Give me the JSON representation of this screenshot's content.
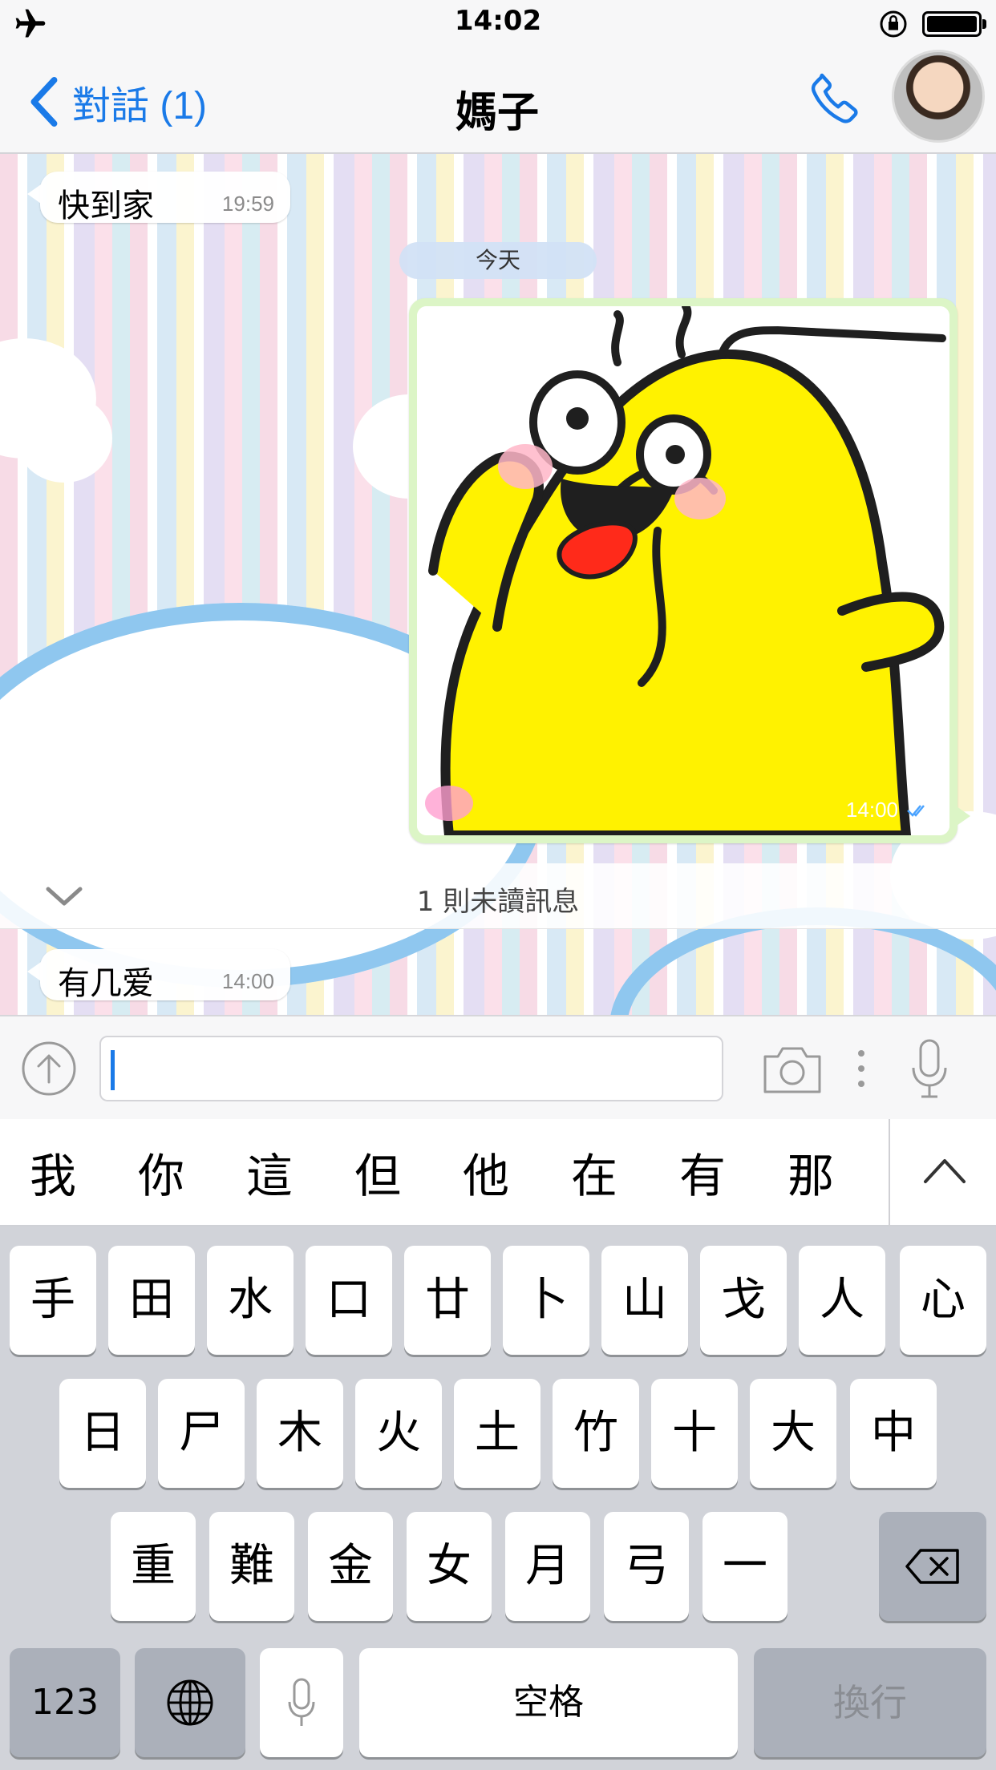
{
  "status_bar": {
    "time": "14:02",
    "icons": [
      "airplane-icon",
      "rotation-lock-icon",
      "battery-icon"
    ]
  },
  "nav": {
    "back_label": "對話 (1)",
    "title": "媽子",
    "phone_icon": "phone-icon",
    "avatar_icon": "avatar"
  },
  "chat": {
    "messages": [
      {
        "direction": "incoming",
        "text": "快到家",
        "time": "19:59"
      },
      {
        "direction": "outgoing",
        "type": "sticker",
        "time": "14:00",
        "status": "read-checkmarks"
      },
      {
        "direction": "incoming",
        "text": "有几爱",
        "time": "14:00"
      }
    ],
    "date_divider": "今天",
    "unread_banner": "1 則未讀訊息"
  },
  "input": {
    "value": "",
    "placeholder": ""
  },
  "candidates": [
    "我",
    "你",
    "這",
    "但",
    "他",
    "在",
    "有",
    "那"
  ],
  "keyboard": {
    "row1": [
      "手",
      "田",
      "水",
      "口",
      "廿",
      "卜",
      "山",
      "戈",
      "人",
      "心"
    ],
    "row2": [
      "日",
      "尸",
      "木",
      "火",
      "土",
      "竹",
      "十",
      "大",
      "中"
    ],
    "row3": [
      "重",
      "難",
      "金",
      "女",
      "月",
      "弓",
      "一"
    ],
    "numbers_label": "123",
    "space_label": "空格",
    "return_label": "換行"
  },
  "colors": {
    "accent": "#1a7ae8",
    "outgoing_bubble": "#dcf5c6",
    "keyboard_bg": "#d1d3d9"
  }
}
